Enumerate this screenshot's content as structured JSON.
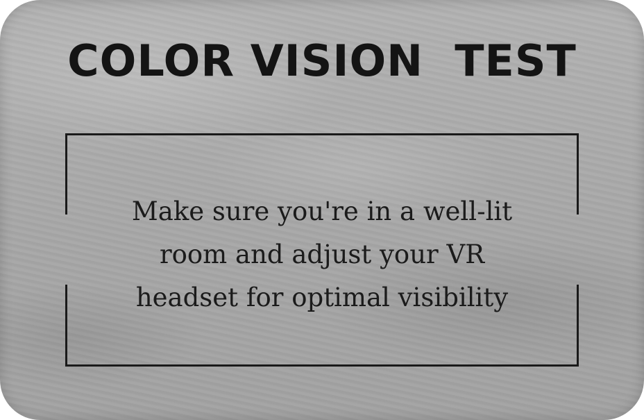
{
  "card": {
    "title": "COLOR VISION  TEST",
    "message_lines": [
      "Make sure you're in a well-lit",
      "room and adjust your VR",
      "headset for optimal visibility"
    ]
  },
  "colors": {
    "background": "#a9a9a9",
    "text": "#141414",
    "frame": "#1a1a1a"
  }
}
